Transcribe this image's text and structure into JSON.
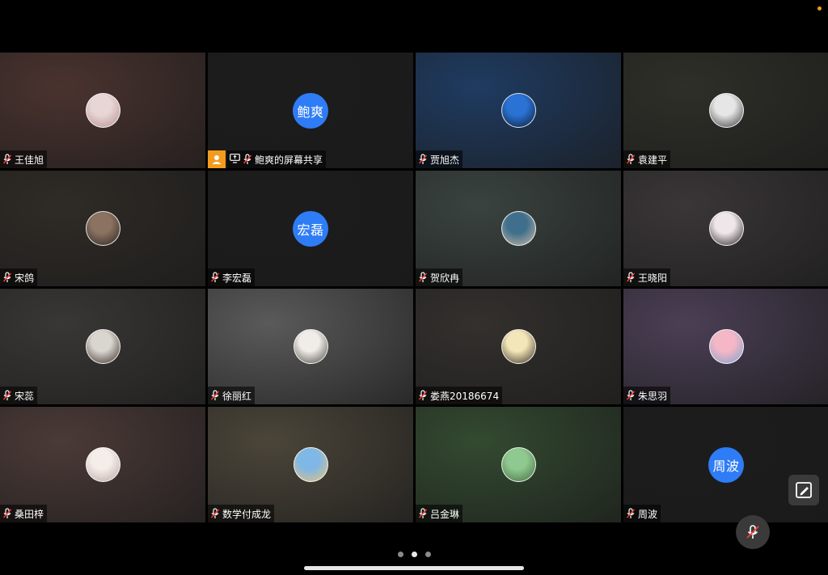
{
  "app": {
    "accent_color": "#2e7cf6",
    "share_badge_color": "#f39b1e",
    "status_dot_color": "#f29a21"
  },
  "participants": [
    {
      "name": "王佳旭",
      "avatar_type": "photo",
      "bg": "#4a332f",
      "avatar_colors": [
        "#e8d6d6",
        "#b88f91"
      ]
    },
    {
      "name": "鲍爽的屏幕共享",
      "avatar_type": "text",
      "avatar_text": "鲍爽",
      "bg": "#1c1c1c",
      "sharing": true
    },
    {
      "name": "贾旭杰",
      "avatar_type": "photo",
      "bg": "#1f3b61",
      "avatar_colors": [
        "#2a73d4",
        "#0e1b33"
      ]
    },
    {
      "name": "袁建平",
      "avatar_type": "photo",
      "bg": "#2e2f28",
      "avatar_colors": [
        "#e6e6e6",
        "#3b3b3b"
      ]
    },
    {
      "name": "宋鸽",
      "avatar_type": "photo",
      "bg": "#2f2b26",
      "avatar_colors": [
        "#8c7361",
        "#2b2521"
      ]
    },
    {
      "name": "李宏磊",
      "avatar_type": "text",
      "avatar_text": "宏磊",
      "bg": "#1c1c1c"
    },
    {
      "name": "贺欣冉",
      "avatar_type": "photo",
      "bg": "#3a4340",
      "avatar_colors": [
        "#3f6f8c",
        "#c8b7a6"
      ]
    },
    {
      "name": "王晓阳",
      "avatar_type": "photo",
      "bg": "#3a3638",
      "avatar_colors": [
        "#efe6ea",
        "#2a2527"
      ]
    },
    {
      "name": "宋蕊",
      "avatar_type": "photo",
      "bg": "#393735",
      "avatar_colors": [
        "#d9d5cf",
        "#3b2f28"
      ]
    },
    {
      "name": "徐丽红",
      "avatar_type": "photo",
      "bg": "#5a5a5a",
      "avatar_colors": [
        "#f0ede8",
        "#4e4a45"
      ]
    },
    {
      "name": "娄燕20186674",
      "avatar_type": "photo",
      "bg": "#33302d",
      "avatar_colors": [
        "#f3e6b8",
        "#3a3127"
      ]
    },
    {
      "name": "朱思羽",
      "avatar_type": "photo",
      "bg": "#4b3f55",
      "avatar_colors": [
        "#f5b7c6",
        "#7ea0cf"
      ]
    },
    {
      "name": "桑田梓",
      "avatar_type": "photo",
      "bg": "#4b3a37",
      "avatar_colors": [
        "#f4ede9",
        "#b9a7a5"
      ]
    },
    {
      "name": "数学付成龙",
      "avatar_type": "photo",
      "bg": "#4b4539",
      "avatar_colors": [
        "#7fb7e6",
        "#e9c27a"
      ]
    },
    {
      "name": "吕金琳",
      "avatar_type": "photo",
      "bg": "#334a30",
      "avatar_colors": [
        "#8fc98f",
        "#456b44"
      ]
    },
    {
      "name": "周波",
      "avatar_type": "text",
      "avatar_text": "周波",
      "bg": "#1c1c1c"
    }
  ],
  "pagination": {
    "total": 3,
    "current": 2
  },
  "controls": {
    "edit_icon": "edit-icon",
    "mute_icon": "mic-muted-icon"
  }
}
